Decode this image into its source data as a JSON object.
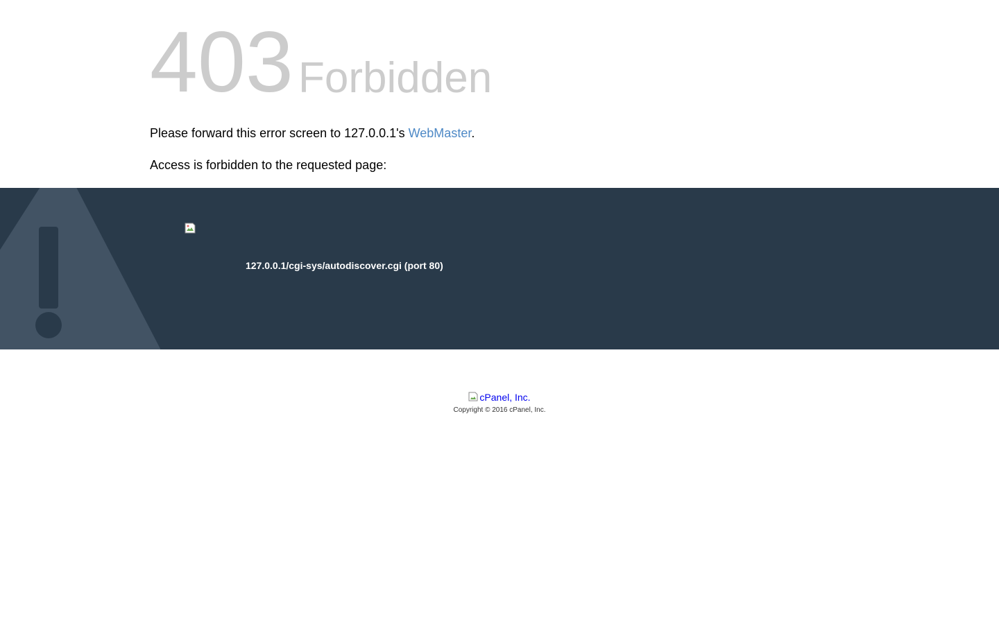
{
  "error": {
    "code": "403",
    "title": "Forbidden"
  },
  "messages": {
    "forward_prefix": "Please forward this error screen to 127.0.0.1's ",
    "forward_link": "WebMaster",
    "forward_suffix": ".",
    "access_text": "Access is forbidden to the requested page:"
  },
  "request": {
    "url": "127.0.0.1/cgi-sys/autodiscover.cgi (port 80)"
  },
  "footer": {
    "logo_alt": "cPanel, Inc.",
    "copyright": "Copyright © 2016 cPanel, Inc."
  },
  "colors": {
    "band_background": "#293a4a",
    "heading_gray": "#cccccc",
    "link_blue": "#4e89c6",
    "warning_icon": "#425364"
  },
  "icons": {
    "warning": "warning-triangle-icon",
    "broken_image": "broken-image-icon"
  }
}
